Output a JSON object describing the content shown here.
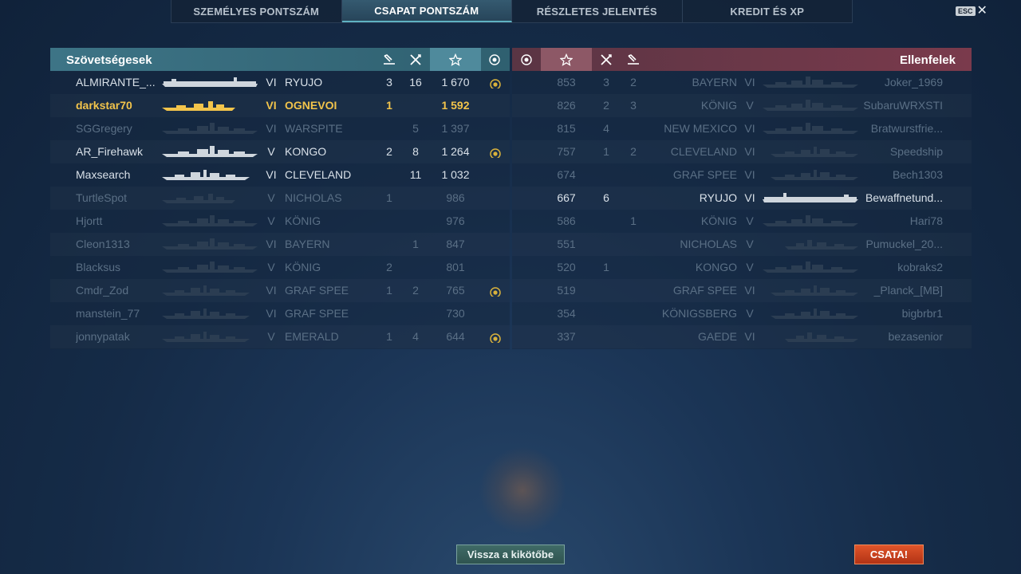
{
  "tabs": [
    "SZEMÉLYES PONTSZÁM",
    "CSAPAT PONTSZÁM",
    "RÉSZLETES JELENTÉS",
    "KREDIT ÉS XP"
  ],
  "active_tab": 1,
  "esc_label": "ESC",
  "allies": {
    "title": "Szövetségesek",
    "players": [
      {
        "name": "ALMIRANTE_...",
        "tier": "VI",
        "ship": "RYUJO",
        "planes": "3",
        "kills": "16",
        "score": "1 670",
        "medal": true,
        "state": "alive",
        "silhouette": "carrier"
      },
      {
        "name": "darkstar70",
        "tier": "VI",
        "ship": "OGNEVOI",
        "planes": "1",
        "kills": "",
        "score": "1 592",
        "medal": false,
        "state": "me",
        "silhouette": "destroyer"
      },
      {
        "name": "SGGregery",
        "tier": "VI",
        "ship": "WARSPITE",
        "planes": "",
        "kills": "5",
        "score": "1 397",
        "medal": false,
        "state": "dead",
        "silhouette": "battleship"
      },
      {
        "name": "AR_Firehawk",
        "tier": "V",
        "ship": "KONGO",
        "planes": "2",
        "kills": "8",
        "score": "1 264",
        "medal": true,
        "state": "alive",
        "silhouette": "battleship"
      },
      {
        "name": "Maxsearch",
        "tier": "VI",
        "ship": "CLEVELAND",
        "planes": "",
        "kills": "11",
        "score": "1 032",
        "medal": false,
        "state": "alive",
        "silhouette": "cruiser"
      },
      {
        "name": "TurtleSpot",
        "tier": "V",
        "ship": "NICHOLAS",
        "planes": "1",
        "kills": "",
        "score": "986",
        "medal": false,
        "state": "dead",
        "silhouette": "destroyer"
      },
      {
        "name": "Hjortt",
        "tier": "V",
        "ship": "KÖNIG",
        "planes": "",
        "kills": "",
        "score": "976",
        "medal": false,
        "state": "dead",
        "silhouette": "battleship"
      },
      {
        "name": "Cleon1313",
        "tier": "VI",
        "ship": "BAYERN",
        "planes": "",
        "kills": "1",
        "score": "847",
        "medal": false,
        "state": "dead",
        "silhouette": "battleship"
      },
      {
        "name": "Blacksus",
        "tier": "V",
        "ship": "KÖNIG",
        "planes": "2",
        "kills": "",
        "score": "801",
        "medal": false,
        "state": "dead",
        "silhouette": "battleship"
      },
      {
        "name": "Cmdr_Zod",
        "tier": "VI",
        "ship": "GRAF SPEE",
        "planes": "1",
        "kills": "2",
        "score": "765",
        "medal": true,
        "state": "dead",
        "silhouette": "cruiser"
      },
      {
        "name": "manstein_77",
        "tier": "VI",
        "ship": "GRAF SPEE",
        "planes": "",
        "kills": "",
        "score": "730",
        "medal": false,
        "state": "dead",
        "silhouette": "cruiser"
      },
      {
        "name": "jonnypatak",
        "tier": "V",
        "ship": "EMERALD",
        "planes": "1",
        "kills": "4",
        "score": "644",
        "medal": true,
        "state": "dead",
        "silhouette": "cruiser"
      }
    ]
  },
  "enemies": {
    "title": "Ellenfelek",
    "players": [
      {
        "score": "853",
        "kills": "3",
        "planes": "2",
        "ship": "BAYERN",
        "tier": "VI",
        "name": "Joker_1969",
        "state": "dead",
        "silhouette": "battleship"
      },
      {
        "score": "826",
        "kills": "2",
        "planes": "3",
        "ship": "KÖNIG",
        "tier": "V",
        "name": "SubaruWRXSTI",
        "state": "dead",
        "silhouette": "battleship"
      },
      {
        "score": "815",
        "kills": "4",
        "planes": "",
        "ship": "NEW MEXICO",
        "tier": "VI",
        "name": "Bratwurstfrie...",
        "state": "dead",
        "silhouette": "battleship"
      },
      {
        "score": "757",
        "kills": "1",
        "planes": "2",
        "ship": "CLEVELAND",
        "tier": "VI",
        "name": "Speedship",
        "state": "dead",
        "silhouette": "cruiser"
      },
      {
        "score": "674",
        "kills": "",
        "planes": "",
        "ship": "GRAF SPEE",
        "tier": "VI",
        "name": "Bech1303",
        "state": "dead",
        "silhouette": "cruiser"
      },
      {
        "score": "667",
        "kills": "6",
        "planes": "",
        "ship": "RYUJO",
        "tier": "VI",
        "name": "Bewaffnetund...",
        "state": "alive",
        "silhouette": "carrier"
      },
      {
        "score": "586",
        "kills": "",
        "planes": "1",
        "ship": "KÖNIG",
        "tier": "V",
        "name": "Hari78",
        "state": "dead",
        "silhouette": "battleship"
      },
      {
        "score": "551",
        "kills": "",
        "planes": "",
        "ship": "NICHOLAS",
        "tier": "V",
        "name": "Pumuckel_20...",
        "state": "dead",
        "silhouette": "destroyer"
      },
      {
        "score": "520",
        "kills": "1",
        "planes": "",
        "ship": "KONGO",
        "tier": "V",
        "name": "kobraks2",
        "state": "dead",
        "silhouette": "battleship"
      },
      {
        "score": "519",
        "kills": "",
        "planes": "",
        "ship": "GRAF SPEE",
        "tier": "VI",
        "name": "_Planck_[MB]",
        "state": "dead",
        "silhouette": "cruiser"
      },
      {
        "score": "354",
        "kills": "",
        "planes": "",
        "ship": "KÖNIGSBERG",
        "tier": "V",
        "name": "bigbrbr1",
        "state": "dead",
        "silhouette": "cruiser"
      },
      {
        "score": "337",
        "kills": "",
        "planes": "",
        "ship": "GAEDE",
        "tier": "VI",
        "name": "bezasenior",
        "state": "dead",
        "silhouette": "destroyer"
      }
    ]
  },
  "buttons": {
    "port": "Vissza a kikötőbe",
    "battle": "CSATA!"
  },
  "colors": {
    "ally_header": "#3d7486",
    "enemy_header": "#7a3a4c",
    "me": "#f2c44b",
    "dead": "#5a6f85",
    "alive": "#d8e0e8",
    "battle_button": "#c9401f"
  },
  "icons": {
    "planes_shot": "plane-shot-icon",
    "kills": "crossed-swords-icon",
    "score": "star-icon",
    "medal": "medal-icon"
  }
}
